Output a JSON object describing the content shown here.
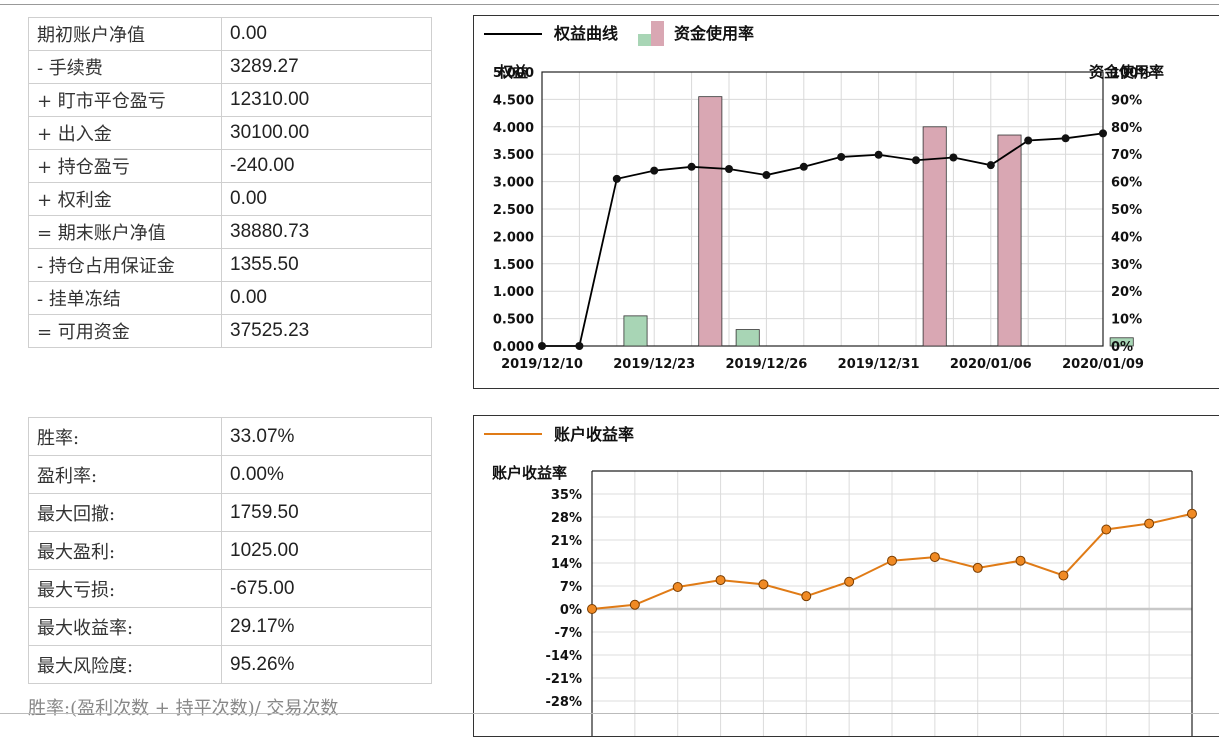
{
  "account_summary": [
    {
      "label": "期初账户净值",
      "value": "0.00"
    },
    {
      "label": "- 手续费",
      "value": "3289.27"
    },
    {
      "label": "+ 盯市平仓盈亏",
      "value": "12310.00"
    },
    {
      "label": "+ 出入金",
      "value": "30100.00"
    },
    {
      "label": "+ 持仓盈亏",
      "value": "-240.00"
    },
    {
      "label": "+ 权利金",
      "value": "0.00"
    },
    {
      "label": "= 期末账户净值",
      "value": "38880.73"
    },
    {
      "label": "- 持仓占用保证金",
      "value": "1355.50"
    },
    {
      "label": "- 挂单冻结",
      "value": "0.00"
    },
    {
      "label": "= 可用资金",
      "value": "37525.23"
    }
  ],
  "performance": [
    {
      "label": "胜率:",
      "value": "33.07%"
    },
    {
      "label": "盈利率:",
      "value": "0.00%"
    },
    {
      "label": "最大回撤:",
      "value": "1759.50"
    },
    {
      "label": "最大盈利:",
      "value": "1025.00"
    },
    {
      "label": "最大亏损:",
      "value": "-675.00"
    },
    {
      "label": "最大收益率:",
      "value": "29.17%"
    },
    {
      "label": "最大风险度:",
      "value": "95.26%"
    }
  ],
  "footnote": "胜率:(盈利次数 + 持平次数)/ 交易次数",
  "chart_data": [
    {
      "type": "bar",
      "legend": [
        "权益曲线",
        "资金使用率"
      ],
      "legend_position": "top-left",
      "ylabel_left": "权益",
      "ylabel_right": "资金使用率",
      "left_ticks": [
        "5.000",
        "4.500",
        "4.000",
        "3.500",
        "3.000",
        "2.500",
        "2.000",
        "1.500",
        "1.000",
        "0.500",
        "0.000"
      ],
      "right_ticks": [
        "100%",
        "90%",
        "80%",
        "70%",
        "60%",
        "50%",
        "40%",
        "30%",
        "20%",
        "10%",
        "0%"
      ],
      "ylim_left": [
        0,
        5.0
      ],
      "ylim_right": [
        0,
        100
      ],
      "x_tick_labels": [
        "2019/12/10",
        "2019/12/23",
        "2019/12/26",
        "2019/12/31",
        "2020/01/06",
        "2020/01/09"
      ],
      "grid": true,
      "series": [
        {
          "name": "权益曲线",
          "axis": "left",
          "kind": "line",
          "color": "#000000",
          "values": [
            0.0,
            0.0,
            3.05,
            3.2,
            3.27,
            3.23,
            3.12,
            3.27,
            3.45,
            3.49,
            3.39,
            3.44,
            3.3,
            3.75,
            3.79,
            3.88
          ]
        },
        {
          "name": "资金使用率",
          "axis": "right",
          "kind": "bar",
          "values": [
            0,
            0,
            11,
            0,
            91,
            6,
            0,
            0,
            0,
            0,
            80,
            0,
            77,
            0,
            0,
            3
          ],
          "colors": [
            "#a8d5b5",
            "#a8d5b5",
            "#a8d5b5",
            "#a8d5b5",
            "#d9a7b3",
            "#a8d5b5",
            "#a8d5b5",
            "#a8d5b5",
            "#a8d5b5",
            "#a8d5b5",
            "#d9a7b3",
            "#a8d5b5",
            "#d9a7b3",
            "#a8d5b5",
            "#a8d5b5",
            "#a8d5b5"
          ]
        }
      ]
    },
    {
      "type": "line",
      "legend": [
        "账户收益率"
      ],
      "legend_position": "top-left",
      "ylabel": "账户收益率",
      "y_ticks": [
        "35%",
        "28%",
        "21%",
        "14%",
        "7%",
        "0%",
        "-7%",
        "-14%",
        "-21%",
        "-28%"
      ],
      "ylim": [
        -30,
        38
      ],
      "grid": true,
      "series": [
        {
          "name": "账户收益率",
          "color": "#e07b16",
          "values": [
            0.0,
            1.3,
            6.7,
            8.8,
            7.5,
            3.9,
            8.3,
            14.7,
            15.8,
            12.5,
            14.7,
            10.2,
            24.2,
            26.0,
            29.0
          ]
        }
      ]
    }
  ]
}
